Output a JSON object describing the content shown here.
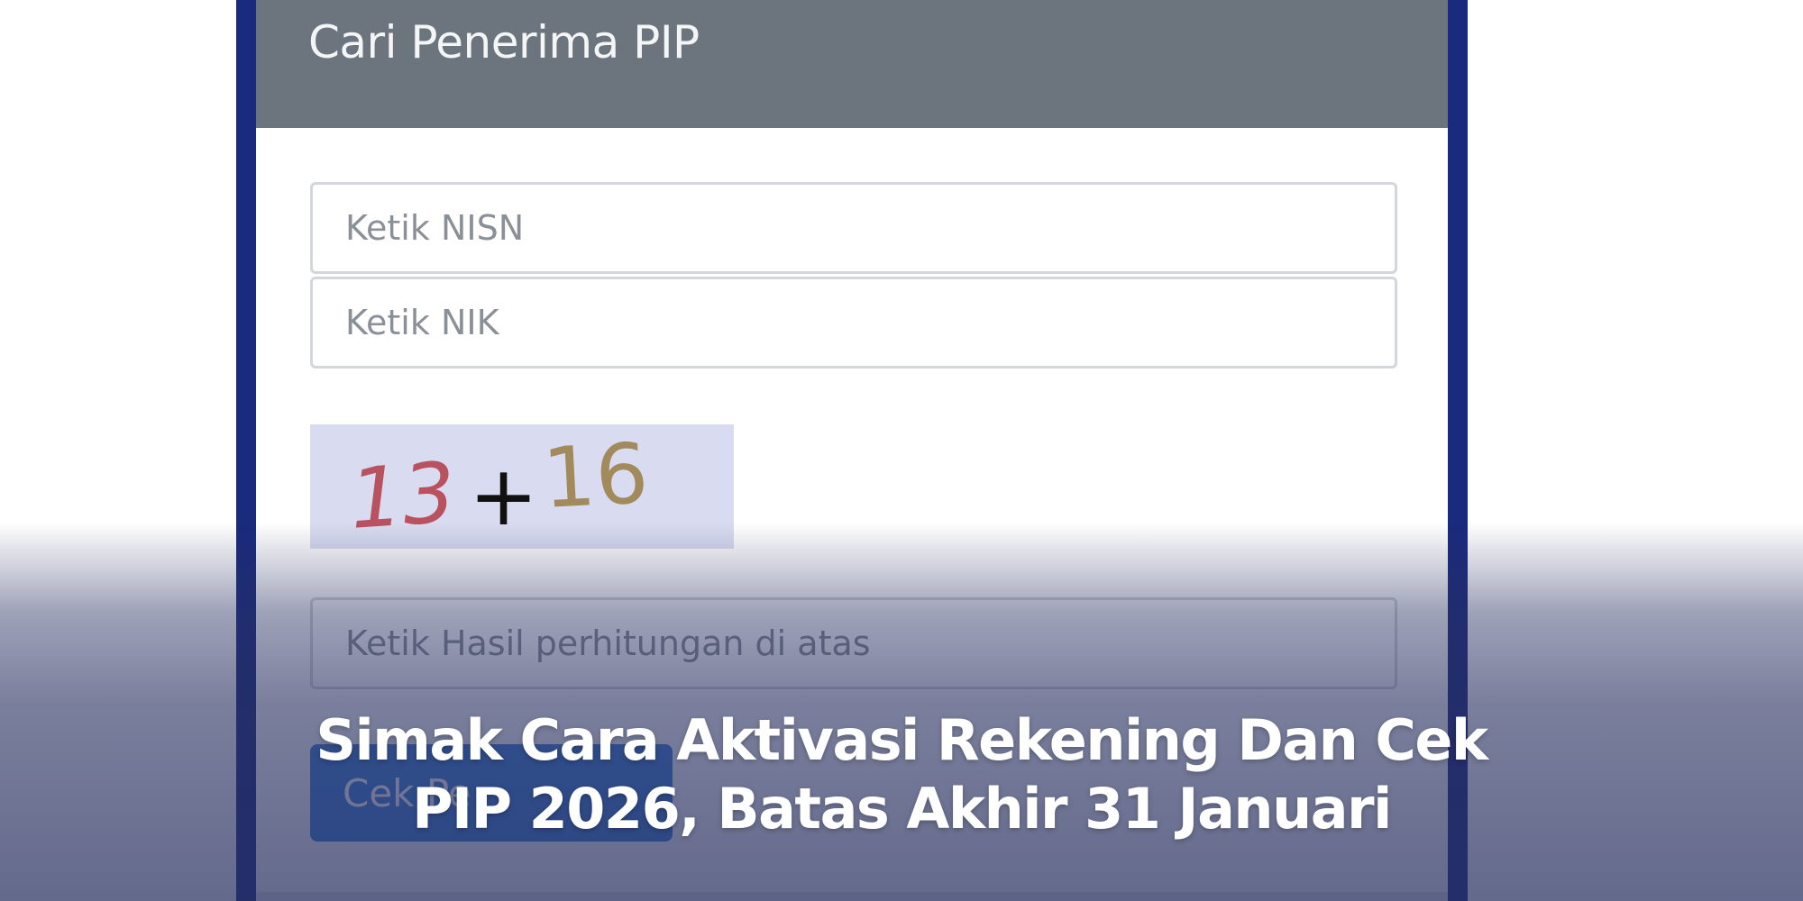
{
  "card": {
    "title": "Cari Penerima PIP"
  },
  "form": {
    "nisn_placeholder": "Ketik NISN",
    "nik_placeholder": "Ketik NIK",
    "captcha": {
      "left": "13",
      "operator": "+",
      "right": "16"
    },
    "result_placeholder": "Ketik Hasil perhitungan di atas",
    "submit_label": "Cek Pe"
  },
  "caption": {
    "line1": "Simak Cara Aktivasi Rekening Dan Cek",
    "line2": "PIP 2026, Batas Akhir 31 Januari"
  },
  "colors": {
    "header_bg": "#6c757d",
    "frame_border": "#1a2a7c",
    "button_bg": "#3d7fd6",
    "captcha_bg": "#d9dcf0"
  }
}
